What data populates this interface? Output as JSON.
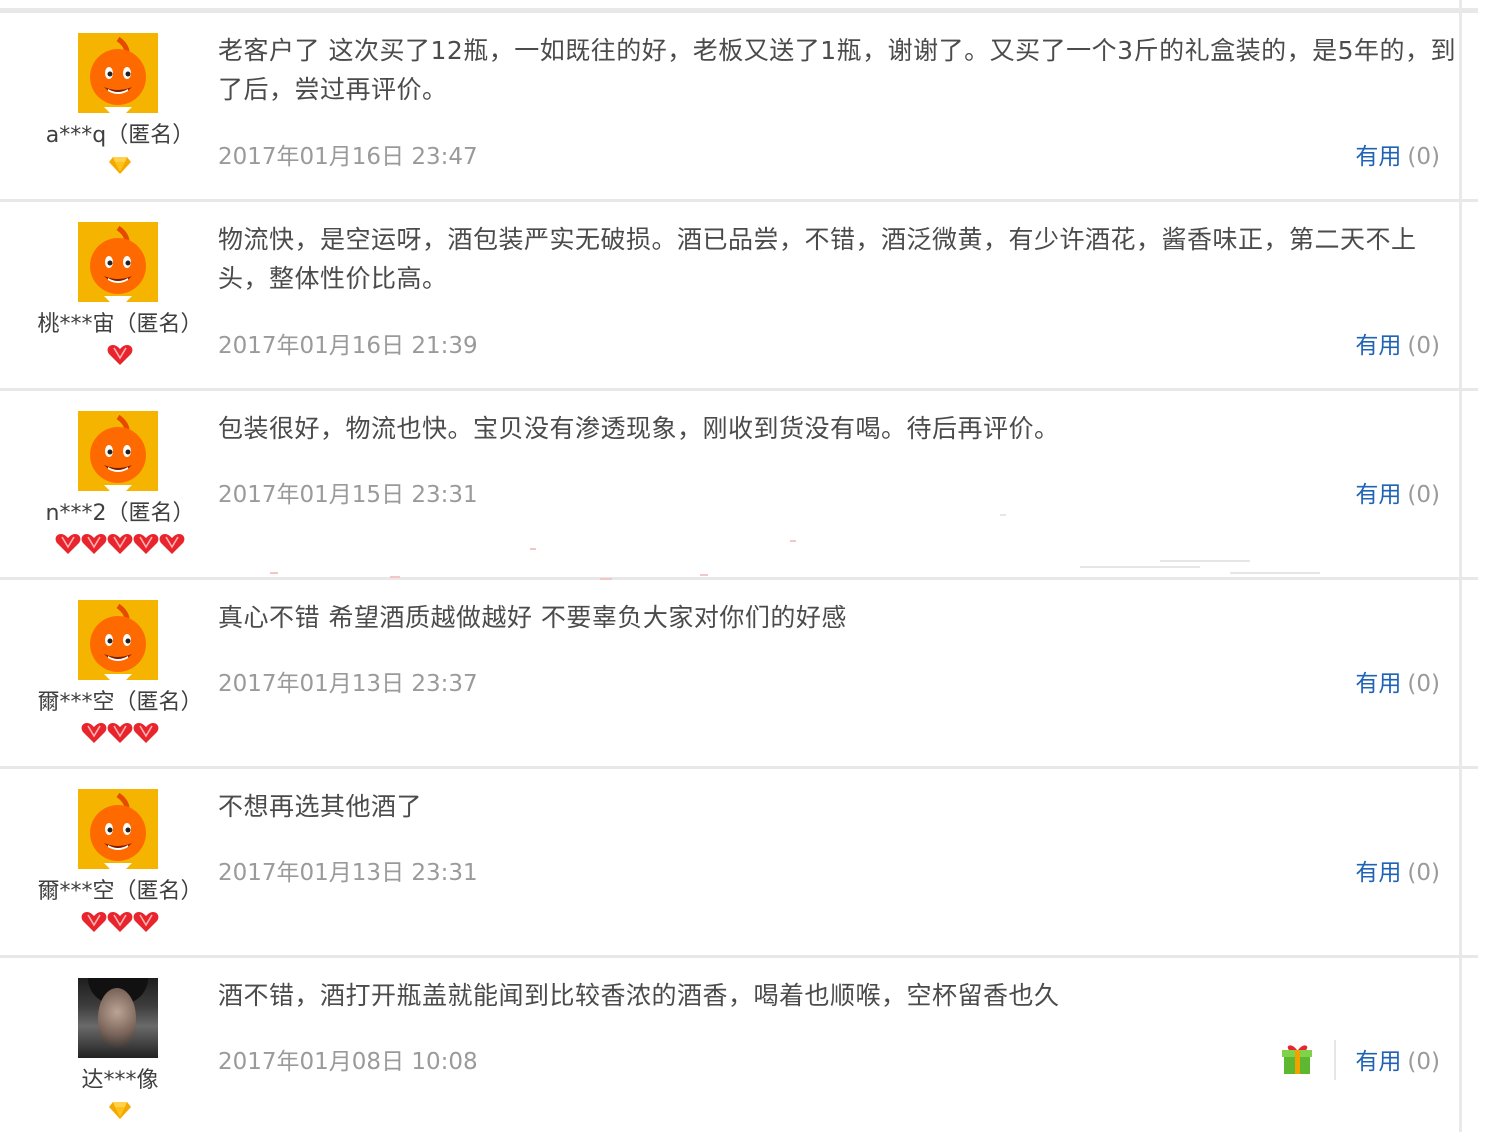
{
  "reviews": [
    {
      "user": "a***q（匿名）",
      "avatar": "taobao-mascot-avatar",
      "level_icon": "diamond-icon",
      "level_count": 1,
      "content": "老客户了 这次买了12瓶，一如既往的好，老板又送了1瓶，谢谢了。又买了一个3斤的礼盒装的，是5年的，到了后，尝过再评价。",
      "date": "2017年01月16日 23:47",
      "useful_label": "有用",
      "useful_count": "(0)"
    },
    {
      "user": "桃***宙（匿名）",
      "avatar": "taobao-mascot-avatar",
      "level_icon": "heart-icon",
      "level_count": 1,
      "content": "物流快，是空运呀，酒包装严实无破损。酒已品尝，不错，酒泛微黄，有少许酒花，酱香味正，第二天不上头，整体性价比高。",
      "date": "2017年01月16日 21:39",
      "useful_label": "有用",
      "useful_count": "(0)"
    },
    {
      "user": "n***2（匿名）",
      "avatar": "taobao-mascot-avatar",
      "level_icon": "heart-icon",
      "level_count": 5,
      "content": "包装很好，物流也快。宝贝没有渗透现象，刚收到货没有喝。待后再评价。",
      "date": "2017年01月15日 23:31",
      "useful_label": "有用",
      "useful_count": "(0)"
    },
    {
      "user": "爾***空（匿名）",
      "avatar": "taobao-mascot-avatar",
      "level_icon": "heart-icon",
      "level_count": 3,
      "content": "真心不错 希望酒质越做越好 不要辜负大家对你们的好感",
      "date": "2017年01月13日 23:37",
      "useful_label": "有用",
      "useful_count": "(0)"
    },
    {
      "user": "爾***空（匿名）",
      "avatar": "taobao-mascot-avatar",
      "level_icon": "heart-icon",
      "level_count": 3,
      "content": "不想再选其他酒了",
      "date": "2017年01月13日 23:31",
      "useful_label": "有用",
      "useful_count": "(0)"
    },
    {
      "user": "达***像",
      "avatar": "photo-avatar",
      "level_icon": "diamond-icon",
      "level_count": 1,
      "content": "酒不错，酒打开瓶盖就能闻到比较香浓的酒香，喝着也顺喉，空杯留香也久",
      "date": "2017年01月08日 10:08",
      "useful_label": "有用",
      "useful_count": "(0)",
      "has_gift_icon": true
    }
  ],
  "colors": {
    "useful_link": "#1f63b6",
    "date_text": "#9a9a9a",
    "mascot_bg": "#f5b400",
    "heart": "#e8242c",
    "diamond": "#f6a800"
  }
}
